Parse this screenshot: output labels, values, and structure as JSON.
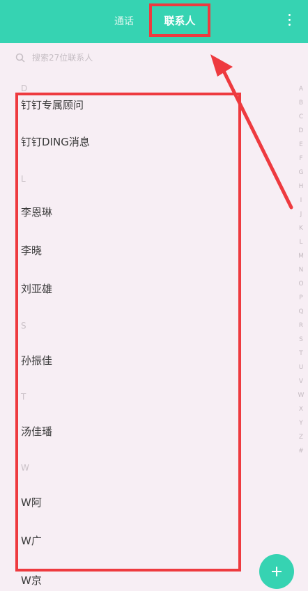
{
  "header": {
    "tabs": [
      {
        "label": "通话",
        "active": false
      },
      {
        "label": "联系人",
        "active": true
      }
    ],
    "menu_icon": "more-vertical-icon"
  },
  "search": {
    "placeholder": "搜索27位联系人",
    "icon": "search-icon"
  },
  "contacts": {
    "sections": [
      {
        "letter": "D",
        "items": [
          "钉钉专属顾问",
          "钉钉DING消息"
        ]
      },
      {
        "letter": "L",
        "items": [
          "李恩琳",
          "李晓",
          "刘亚雄"
        ]
      },
      {
        "letter": "S",
        "items": [
          "孙振佳"
        ]
      },
      {
        "letter": "T",
        "items": [
          "汤佳璠"
        ]
      },
      {
        "letter": "W",
        "items": [
          "W阿",
          "W广",
          "W京"
        ]
      }
    ]
  },
  "index_letters": [
    "A",
    "B",
    "C",
    "D",
    "E",
    "F",
    "G",
    "H",
    "I",
    "J",
    "K",
    "L",
    "M",
    "N",
    "O",
    "P",
    "Q",
    "R",
    "S",
    "T",
    "U",
    "V",
    "W",
    "X",
    "Y",
    "Z",
    "#"
  ],
  "fab": {
    "icon": "plus-icon"
  },
  "colors": {
    "accent": "#36d3b2",
    "annotation": "#ee3a3f",
    "background": "#f7eef4"
  }
}
